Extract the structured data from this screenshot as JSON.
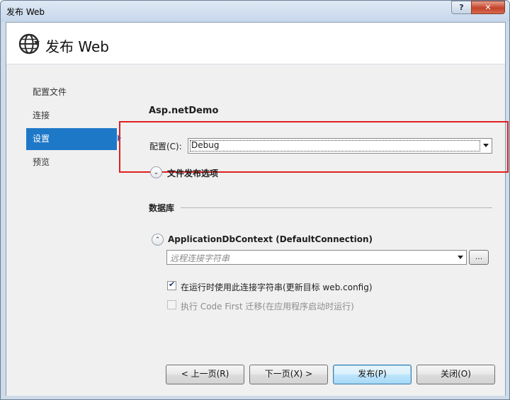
{
  "window": {
    "title": "发布 Web",
    "help_label": "?",
    "close_label": "✕"
  },
  "header": {
    "title": "发布 Web",
    "icon": "globe-publish-icon"
  },
  "nav": {
    "items": [
      {
        "label": "配置文件"
      },
      {
        "label": "连接"
      },
      {
        "label": "设置",
        "selected": true
      },
      {
        "label": "预览"
      }
    ]
  },
  "settings": {
    "project_name": "Asp.netDemo",
    "config_label": "配置(C):",
    "config_value": "Debug",
    "file_options_label": "文件发布选项",
    "database_header": "数据库",
    "db_context_label": "ApplicationDbContext (DefaultConnection)",
    "conn_string_placeholder": "远程连接字符串",
    "ellipsis_label": "...",
    "use_conn_string_label": "在运行时使用此连接字符串(更新目标 web.config)",
    "use_conn_string_checked": true,
    "code_first_label": "执行 Code First 迁移(在应用程序启动时运行)",
    "code_first_checked": false
  },
  "buttons": {
    "prev": "< 上一页(R)",
    "next": "下一页(X) >",
    "publish": "发布(P)",
    "close": "关闭(O)"
  },
  "colors": {
    "accent": "#1e78c8",
    "highlight": "#e02020"
  }
}
